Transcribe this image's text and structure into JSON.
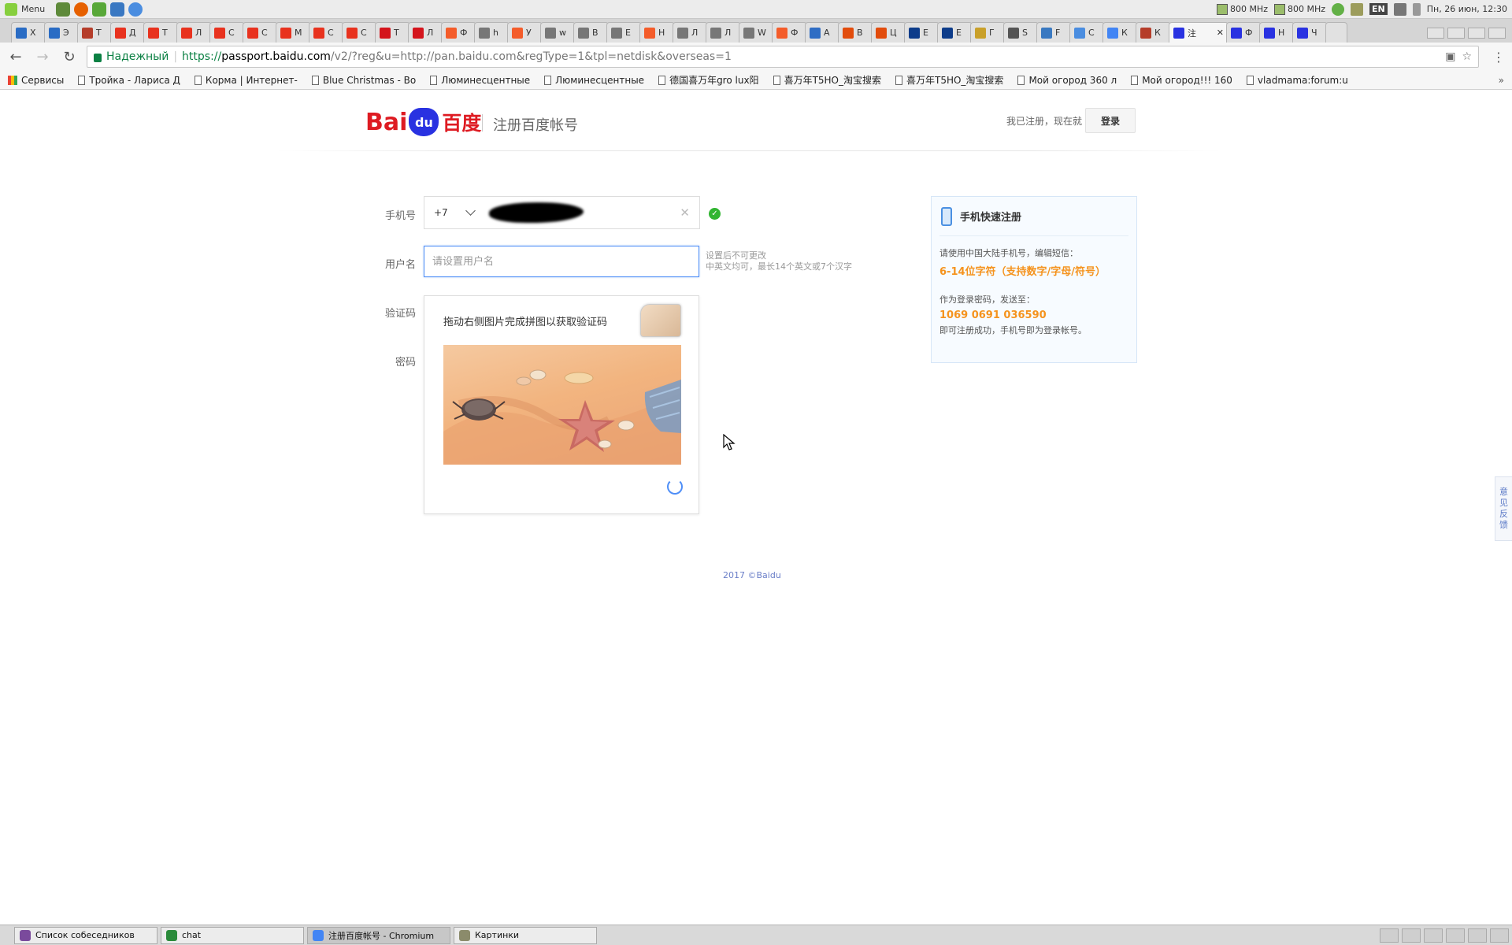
{
  "system_panel": {
    "menu_label": "Menu",
    "cpu1": "800 MHz",
    "cpu2": "800 MHz",
    "lang": "EN",
    "clock": "Пн, 26 июн, 12:30"
  },
  "tabs": [
    {
      "label": "X",
      "color": "#2a6cc4"
    },
    {
      "label": "Э",
      "color": "#2a6cc4"
    },
    {
      "label": "Т",
      "color": "#b53d2a"
    },
    {
      "label": "Д",
      "color": "#e8321e"
    },
    {
      "label": "Т",
      "color": "#e8321e"
    },
    {
      "label": "Л",
      "color": "#e8321e"
    },
    {
      "label": "С",
      "color": "#e8321e"
    },
    {
      "label": "С",
      "color": "#e8321e"
    },
    {
      "label": "М",
      "color": "#e8321e"
    },
    {
      "label": "С",
      "color": "#e8321e"
    },
    {
      "label": "С",
      "color": "#e8321e"
    },
    {
      "label": "Т",
      "color": "#d4141c"
    },
    {
      "label": "Л",
      "color": "#d4141c"
    },
    {
      "label": "Ф",
      "color": "#f45c2a"
    },
    {
      "label": "h",
      "color": "#777777"
    },
    {
      "label": "У",
      "color": "#f45c2a"
    },
    {
      "label": "w",
      "color": "#777777"
    },
    {
      "label": "В",
      "color": "#777777"
    },
    {
      "label": "Е",
      "color": "#777777"
    },
    {
      "label": "Н",
      "color": "#f45c2a"
    },
    {
      "label": "Л",
      "color": "#777777"
    },
    {
      "label": "Л",
      "color": "#777777"
    },
    {
      "label": "W",
      "color": "#777777"
    },
    {
      "label": "Ф",
      "color": "#f45c2a"
    },
    {
      "label": "А",
      "color": "#2f6dc4"
    },
    {
      "label": "В",
      "color": "#e24c0c"
    },
    {
      "label": "Ц",
      "color": "#e24c0c"
    },
    {
      "label": "Е",
      "color": "#0d3c8a"
    },
    {
      "label": "Е",
      "color": "#0d3c8a"
    },
    {
      "label": "Г",
      "color": "#c9a02a"
    },
    {
      "label": "S",
      "color": "#555555"
    },
    {
      "label": "F",
      "color": "#3a79c1"
    },
    {
      "label": "С",
      "color": "#4a8de0"
    },
    {
      "label": "К",
      "color": "#4285f4"
    },
    {
      "label": "К",
      "color": "#b53d2a"
    },
    {
      "label": "注",
      "color": "#2932e1",
      "active": true
    },
    {
      "label": "Ф",
      "color": "#2932e1"
    },
    {
      "label": "Н",
      "color": "#2932e1"
    },
    {
      "label": "Ч",
      "color": "#2932e1"
    }
  ],
  "toolbar": {
    "secure_label": "Надежный",
    "url_proto": "https://",
    "url_host": "passport.baidu.com",
    "url_rest": "/v2/?reg&u=http://pan.baidu.com&regType=1&tpl=netdisk&overseas=1"
  },
  "bookmarks": {
    "apps_label": "Сервисы",
    "items": [
      "Тройка - Лариса Д",
      "Корма | Интернет-",
      "Blue Christmas - Bo",
      "Люминесцентные",
      "Люминесцентные",
      "德国喜万年gro lux阳",
      "喜万年T5HO_淘宝搜索",
      "喜万年T5HO_淘宝搜索",
      "Мой огород 360 л",
      "Мой огород!!! 160",
      "vladmama:forum:u"
    ],
    "more": "»"
  },
  "header": {
    "logo_bai": "Bai",
    "logo_du": "du",
    "logo_cn": "百度",
    "title": "注册百度帐号",
    "already_text": "我已注册，现在就",
    "login_label": "登录"
  },
  "form": {
    "phone_label": "手机号",
    "country_code": "+7",
    "username_label": "用户名",
    "username_placeholder": "请设置用户名",
    "hint_line1": "设置后不可更改",
    "hint_line2": "中英文均可，最长14个英文或7个汉字",
    "captcha_label": "验证码",
    "password_label": "密码"
  },
  "captcha": {
    "title": "拖动右侧图片完成拼图以获取验证码"
  },
  "quick_register": {
    "title": "手机快速注册",
    "line1": "请使用中国大陆手机号，编辑短信：",
    "strong1": "6-14位字符（支持数字/字母/符号）",
    "line2": "作为登录密码，发送至：",
    "strong2": "1069 0691 036590",
    "line3": "即可注册成功，手机号即为登录帐号。"
  },
  "footer": {
    "copyright": "2017 ©Baidu"
  },
  "feedback": {
    "label": "意见反馈"
  },
  "taskbar": {
    "items": [
      {
        "label": "Список собеседников",
        "color": "#7a4a9c"
      },
      {
        "label": "chat",
        "color": "#2a8a3a"
      },
      {
        "label": "注册百度帐号 - Chromium",
        "color": "#4285f4",
        "active": true
      },
      {
        "label": "Картинки",
        "color": "#8b8b6b"
      }
    ]
  },
  "colors": {
    "baidu_red": "#de1b22",
    "baidu_blue": "#2932e1",
    "accent_orange": "#f5931e",
    "success_green": "#31b531"
  }
}
